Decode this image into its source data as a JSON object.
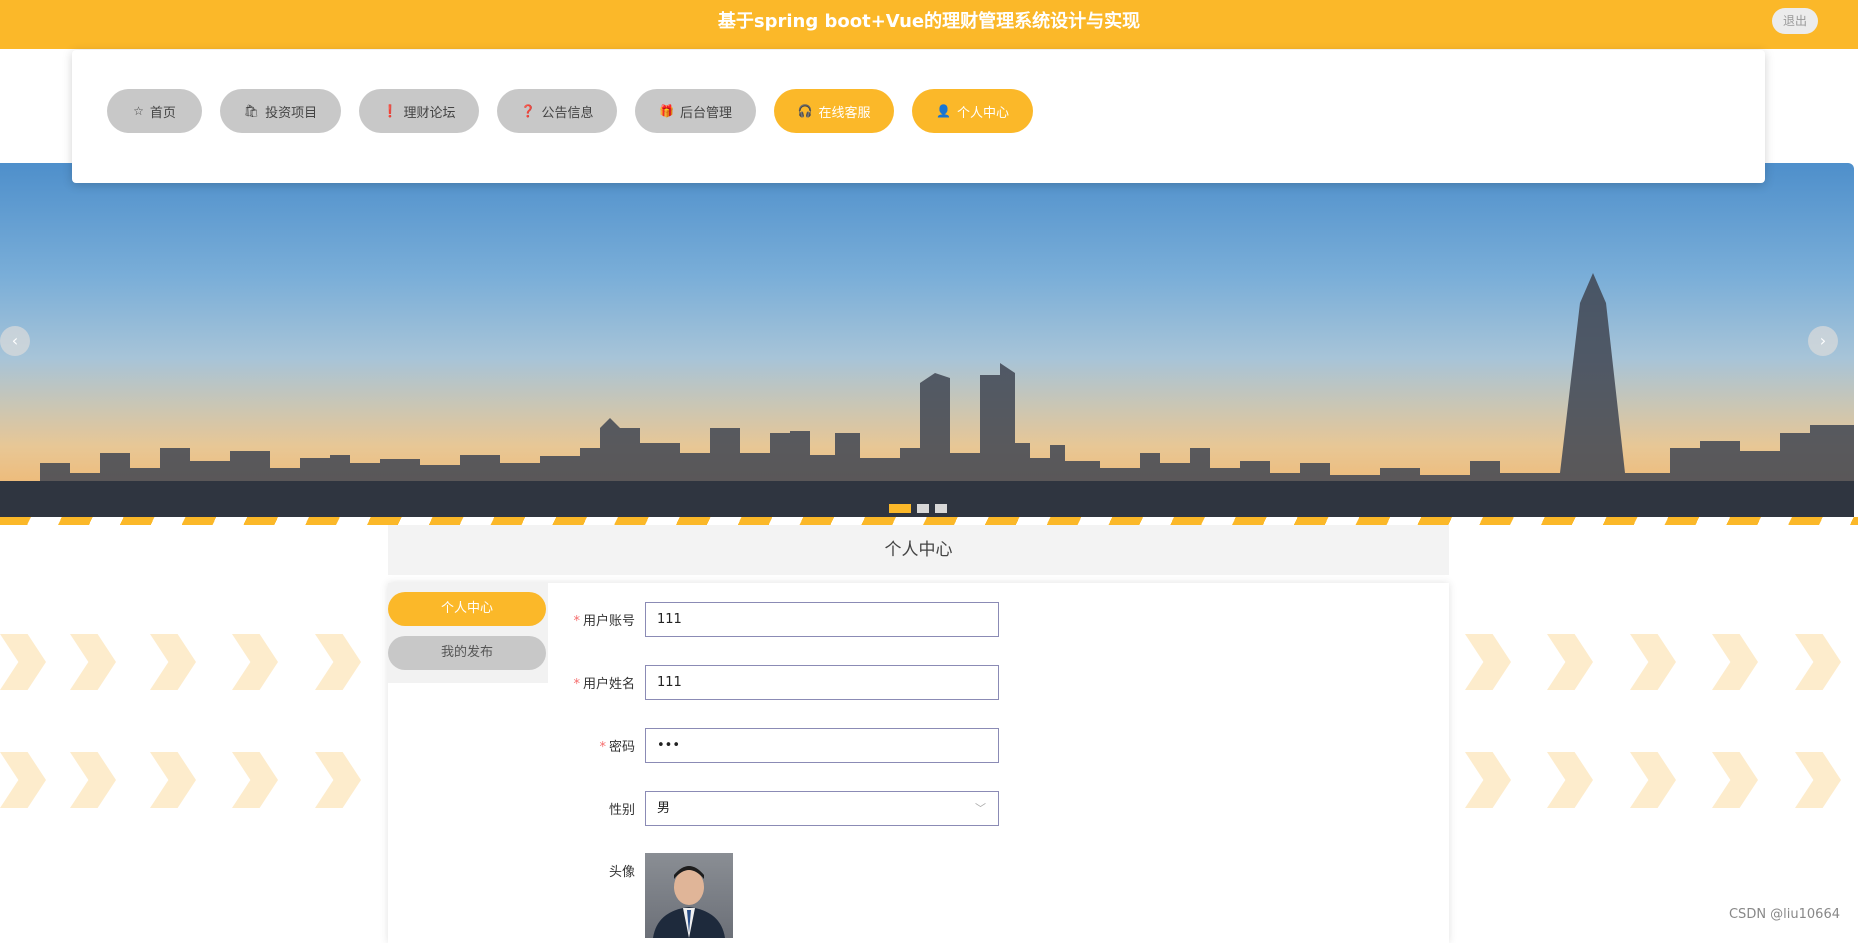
{
  "header": {
    "title": "基于spring boot+Vue的理财管理系统设计与实现",
    "logout_label": "退出"
  },
  "nav": {
    "items": [
      {
        "label": "首页",
        "icon": "star-icon"
      },
      {
        "label": "投资项目",
        "icon": "bag-icon"
      },
      {
        "label": "理财论坛",
        "icon": "alert-icon"
      },
      {
        "label": "公告信息",
        "icon": "question-icon"
      },
      {
        "label": "后台管理",
        "icon": "gift-icon"
      },
      {
        "label": "在线客服",
        "icon": "headset-icon"
      },
      {
        "label": "个人中心",
        "icon": "user-icon"
      }
    ],
    "active_index": 5
  },
  "carousel": {
    "prev_glyph": "‹",
    "next_glyph": "›",
    "slide_count": 3,
    "active_slide": 1
  },
  "section": {
    "title": "个人中心"
  },
  "sidebar": {
    "items": [
      {
        "label": "个人中心",
        "active": true
      },
      {
        "label": "我的发布",
        "active": false
      }
    ]
  },
  "form": {
    "username_label": "用户账号",
    "username_value": "111",
    "name_label": "用户姓名",
    "name_value": "111",
    "password_label": "密码",
    "password_value": "•••",
    "gender_label": "性别",
    "gender_value": "男",
    "avatar_label": "头像",
    "required_mark": "*"
  },
  "watermark": "CSDN @liu10664",
  "colors": {
    "accent": "#fbb829",
    "nav_inactive": "#c8c8c8"
  }
}
